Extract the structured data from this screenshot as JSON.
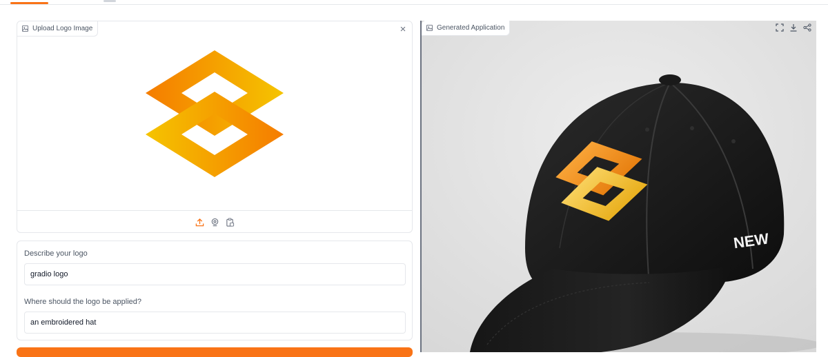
{
  "upload": {
    "label": "Upload Logo Image",
    "toolbar_icons": [
      "upload-icon",
      "webcam-icon",
      "clipboard-icon"
    ]
  },
  "form": {
    "description_label": "Describe your logo",
    "description_value": "gradio logo",
    "placement_label": "Where should the logo be applied?",
    "placement_value": "an embroidered hat"
  },
  "output": {
    "label": "Generated Application",
    "actions": [
      "fullscreen-icon",
      "download-icon",
      "share-icon"
    ],
    "brand_mark_text": "NEW"
  },
  "colors": {
    "accent": "#f97316",
    "logo_orange": "#f57c00",
    "logo_yellow": "#f5c400"
  }
}
